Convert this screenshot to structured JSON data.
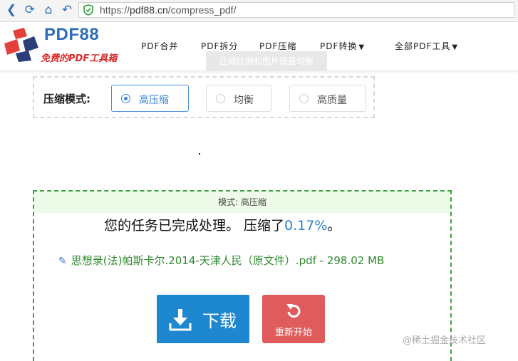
{
  "browser": {
    "url_scheme": "https://",
    "url_host": "pdf88.cn",
    "url_path": "/compress_pdf/"
  },
  "site": {
    "logo_title": "PDF88",
    "logo_subtitle": "免费的PDF工具箱",
    "menu": [
      {
        "label": "PDF合并"
      },
      {
        "label": "PDF拆分"
      },
      {
        "label": "PDF压缩"
      },
      {
        "label": "PDF转换",
        "caret": "▼"
      },
      {
        "label": "全部PDF工具",
        "caret": "▼"
      }
    ],
    "tooltip": "压缩比例和图片质量均衡"
  },
  "compression": {
    "label": "压缩模式:",
    "options": [
      {
        "label": "高压缩",
        "selected": true
      },
      {
        "label": "均衡",
        "selected": false
      },
      {
        "label": "高质量",
        "selected": false
      }
    ]
  },
  "result": {
    "mode_banner": "模式: 高压缩",
    "done_text": "您的任务已完成处理。 压缩了",
    "percent": "0.17%",
    "done_suffix": "。",
    "file_line": "思想录(法)帕斯卡尔.2014-天津人民（原文件）.pdf -  298.02 MB",
    "download_label": "下载",
    "restart_label": "重新开始"
  },
  "watermark": "@稀土掘金技术社区",
  "colors": {
    "brand_blue": "#2f6db8",
    "download_blue": "#1d87cf",
    "restart_red": "#e05b5b",
    "success_green": "#3aa53a"
  }
}
